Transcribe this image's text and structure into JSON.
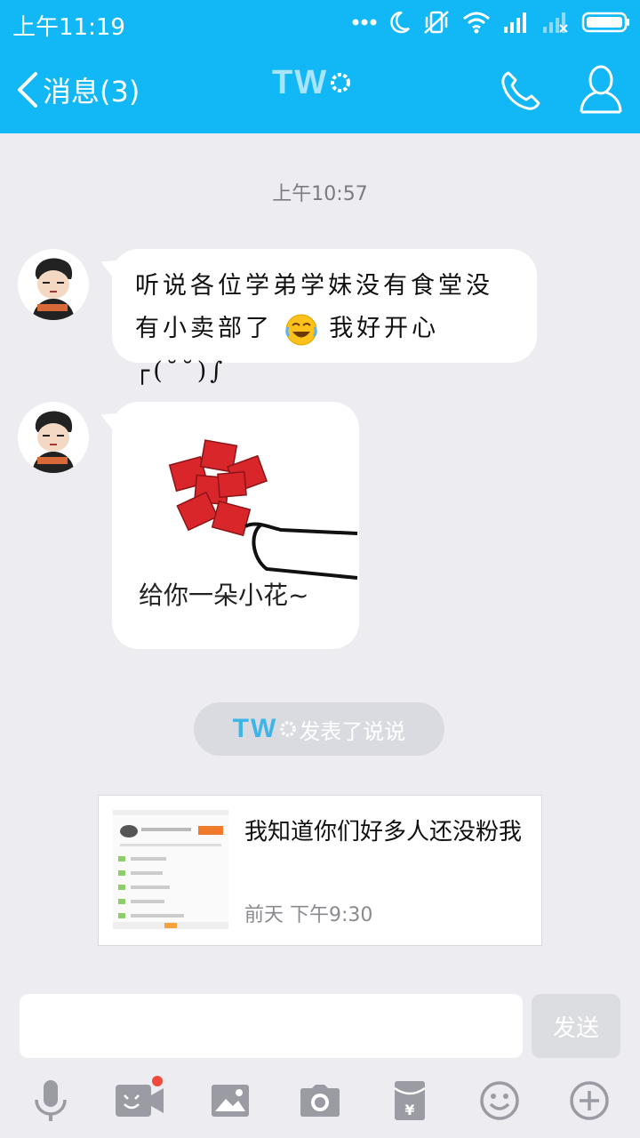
{
  "status_bar": {
    "time": "上午11:19",
    "icons": [
      "more-dots-icon",
      "moon-icon",
      "vibrate-off-icon",
      "wifi-icon",
      "signal-icon",
      "signal-empty-icon",
      "battery-icon"
    ]
  },
  "nav": {
    "back_label": "消息(3)",
    "title_brand": "TW",
    "icons": [
      "back-chevron-icon",
      "phone-icon",
      "profile-icon"
    ]
  },
  "colors": {
    "header_bg": "#12b7f5",
    "chat_bg": "#ececf1",
    "bubble_bg": "#ffffff",
    "pill_bg": "#d9dbe0",
    "brand_text": "#3cb5e8",
    "notification_dot": "#f04a3a"
  },
  "chat": {
    "timestamp": "上午10:57",
    "messages": [
      {
        "type": "text",
        "line1": "听说各位学弟学妹没有食堂没",
        "line2_a": "有小卖部了",
        "emoji": "laughing-crying-emoji",
        "line2_b": "我好开心┌(˘˘)∫"
      },
      {
        "type": "sticker",
        "caption": "给你一朵小花~"
      }
    ],
    "system_notice": {
      "brand": "TW",
      "text": "发表了说说"
    },
    "shared_post": {
      "title": "我知道你们好多人还没粉我",
      "time": "前天 下午9:30"
    }
  },
  "composer": {
    "input_value": "",
    "send_label": "发送"
  },
  "toolbar": {
    "items": [
      "microphone-icon",
      "video-call-icon",
      "image-icon",
      "camera-icon",
      "red-packet-icon",
      "emoji-icon",
      "plus-icon"
    ]
  }
}
